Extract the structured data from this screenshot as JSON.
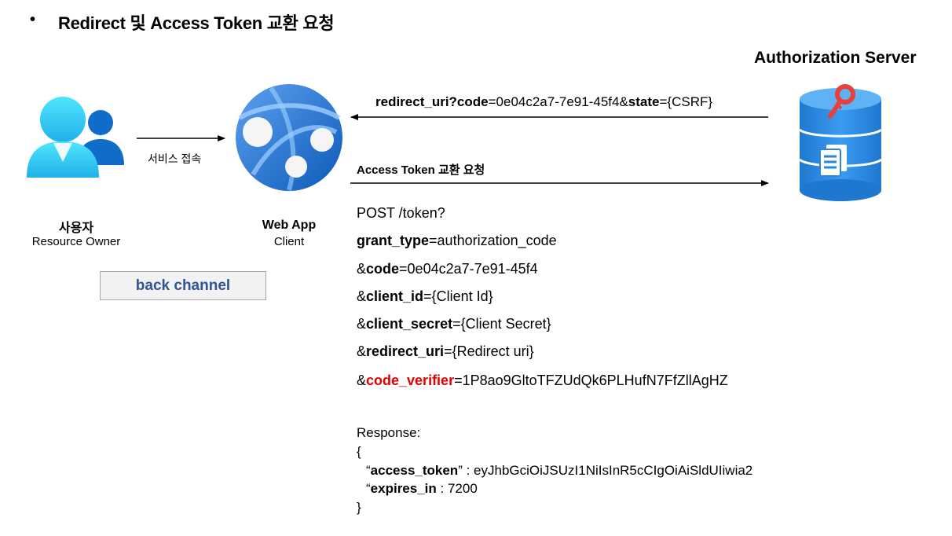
{
  "header": {
    "bullet": "•",
    "title": "Redirect 및 Access Token 교환 요청"
  },
  "resource_owner": {
    "name": "사용자",
    "role": "Resource Owner"
  },
  "service_access_label": "서비스 접속",
  "web_app": {
    "name": "Web App",
    "role": "Client"
  },
  "back_channel_label": "back channel",
  "authorization_server": {
    "title": "Authorization Server"
  },
  "redirect": {
    "param1_name": "redirect_uri?code",
    "param1_value": "=0e04c2a7-7e91-45f4&",
    "param2_name": "state",
    "param2_value": "={CSRF}"
  },
  "token_exchange_label": "Access Token 교환 요청",
  "request": {
    "line0": "POST /token?",
    "params": [
      {
        "prefix": "",
        "name": "grant_type",
        "value": "=authorization_code"
      },
      {
        "prefix": "&",
        "name": "code",
        "value": "=0e04c2a7-7e91-45f4"
      },
      {
        "prefix": "&",
        "name": "client_id",
        "value": "={Client Id}"
      },
      {
        "prefix": "&",
        "name": "client_secret",
        "value": "={Client Secret}"
      },
      {
        "prefix": "&",
        "name": "redirect_uri",
        "value": "={Redirect uri}"
      },
      {
        "prefix": "&",
        "name": "code_verifier",
        "value": "=1P8ao9GltoTFZUdQk6PLHufN7FfZllAgHZ"
      }
    ]
  },
  "response": {
    "label": "Response:",
    "open_brace": "{",
    "quote_open": "“",
    "access_token_key": "access_token",
    "access_token_rest": "” : eyJhbGciOiJSUzI1NiIsInR5cCIgOiAiSldUIiwia2",
    "expires_prefix": "“",
    "expires_in_key": "expires_in",
    "expires_in_rest": " : 7200",
    "close_brace": "}"
  },
  "colors": {
    "accent_blue": "#2f5597",
    "highlight_red": "#e00000",
    "db_blue": "#2e8fe0",
    "key_red": "#e8413a"
  }
}
